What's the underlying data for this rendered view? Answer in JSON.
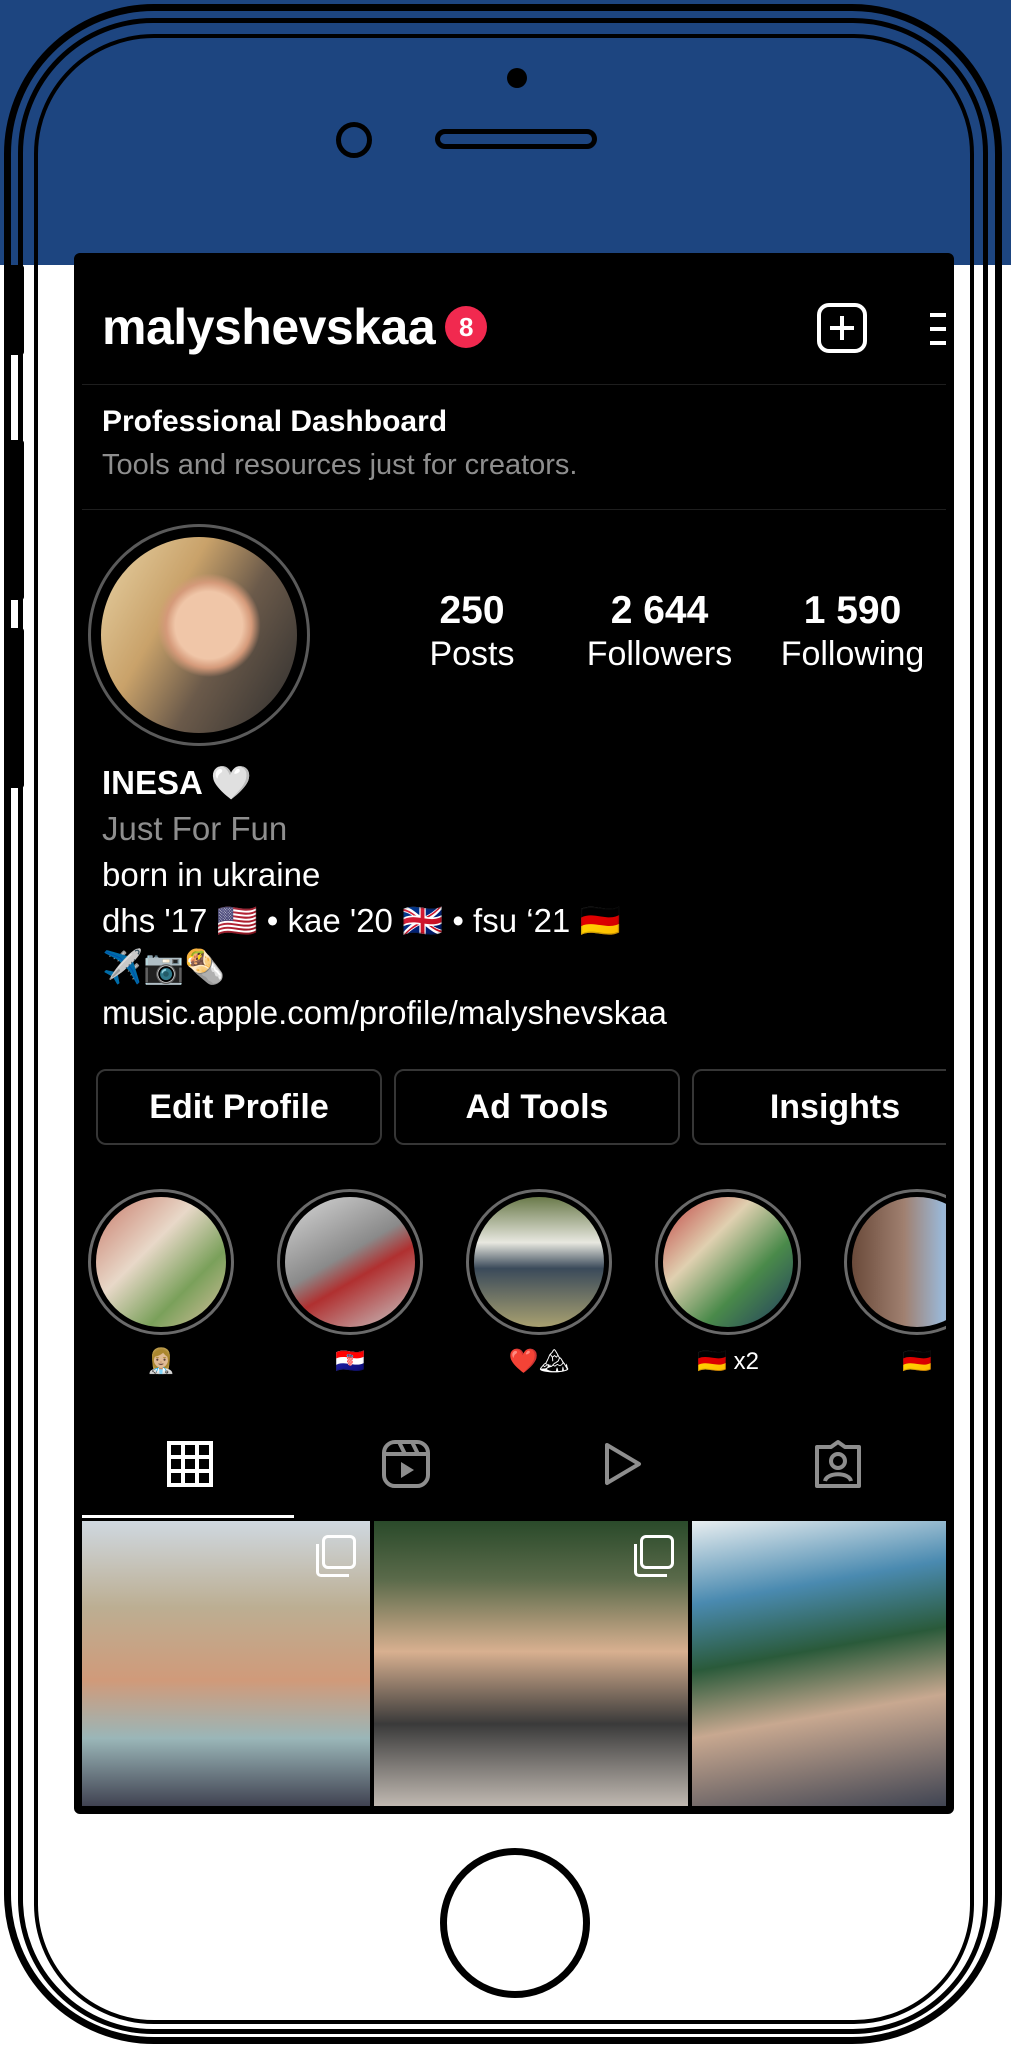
{
  "header": {
    "username": "malyshevskaa",
    "notification_count": "8"
  },
  "dashboard": {
    "title": "Professional Dashboard",
    "subtitle": "Tools and resources just for creators."
  },
  "stats": [
    {
      "num": "250",
      "label": "Posts"
    },
    {
      "num": "2 644",
      "label": "Followers"
    },
    {
      "num": "1 590",
      "label": "Following"
    }
  ],
  "bio": {
    "name": "INESA 🤍",
    "category": "Just For Fun",
    "line1": "born in ukraine",
    "line2": "dhs '17 🇺🇸 • kae '20 🇬🇧 • fsu ‘21 🇩🇪",
    "line3": "✈️📷🌯",
    "link": "music.apple.com/profile/malyshevskaa"
  },
  "buttons": {
    "edit_profile": "Edit Profile",
    "ad_tools": "Ad Tools",
    "insights": "Insights"
  },
  "highlights": [
    {
      "label": "👩🏼‍⚕️"
    },
    {
      "label": "🇭🇷"
    },
    {
      "label": "❤️🏔"
    },
    {
      "label": "🇩🇪 x2"
    },
    {
      "label": "🇩🇪"
    }
  ],
  "tabs": [
    {
      "icon": "grid-icon"
    },
    {
      "icon": "reels-icon"
    },
    {
      "icon": "video-play-icon"
    },
    {
      "icon": "tagged-person-icon"
    }
  ],
  "colors": {
    "background": "#000000",
    "badge": "#f1294f",
    "secondary_text": "#8e8e8e",
    "frame_blue": "#1d4580"
  }
}
